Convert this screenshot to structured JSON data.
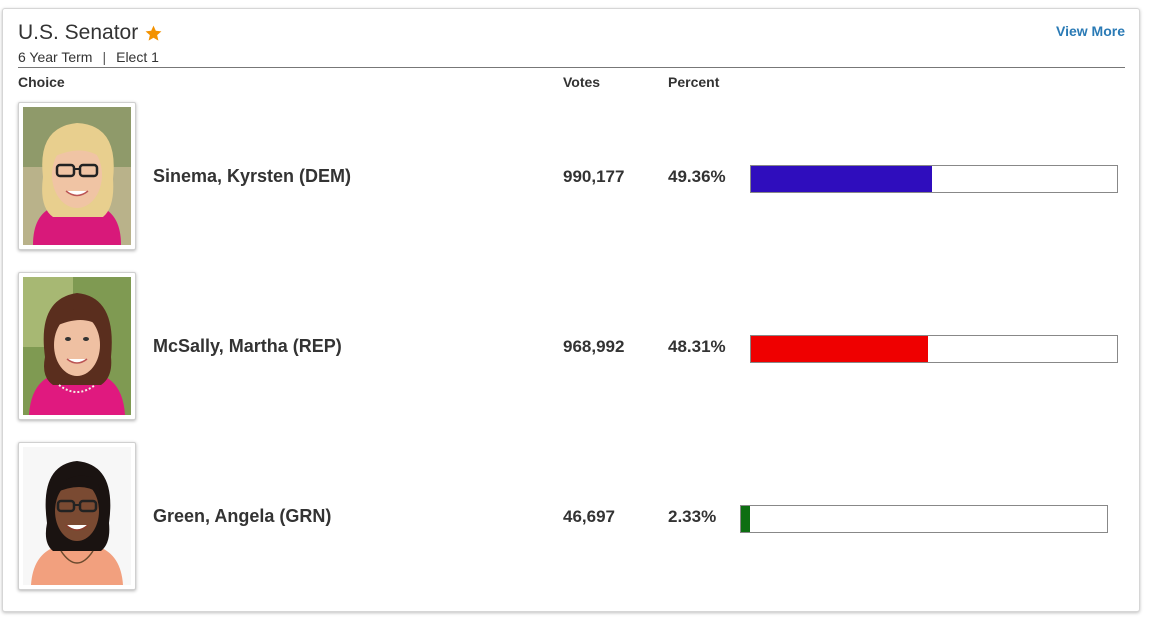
{
  "race": {
    "title": "U.S. Senator",
    "term": "6 Year Term",
    "separator": "|",
    "elect": "Elect 1",
    "view_more": "View More",
    "star_color": "#f39200"
  },
  "columns": {
    "choice": "Choice",
    "votes": "Votes",
    "percent": "Percent"
  },
  "candidates": [
    {
      "name": "Sinema, Kyrsten (DEM)",
      "votes": "990,177",
      "percent": "49.36%",
      "share": 0.4936,
      "color": "#2f0dbd"
    },
    {
      "name": "McSally, Martha (REP)",
      "votes": "968,992",
      "percent": "48.31%",
      "share": 0.4831,
      "color": "#ef0000"
    },
    {
      "name": "Green, Angela (GRN)",
      "votes": "46,697",
      "percent": "2.33%",
      "share": 0.0233,
      "color": "#0d6e12"
    }
  ]
}
